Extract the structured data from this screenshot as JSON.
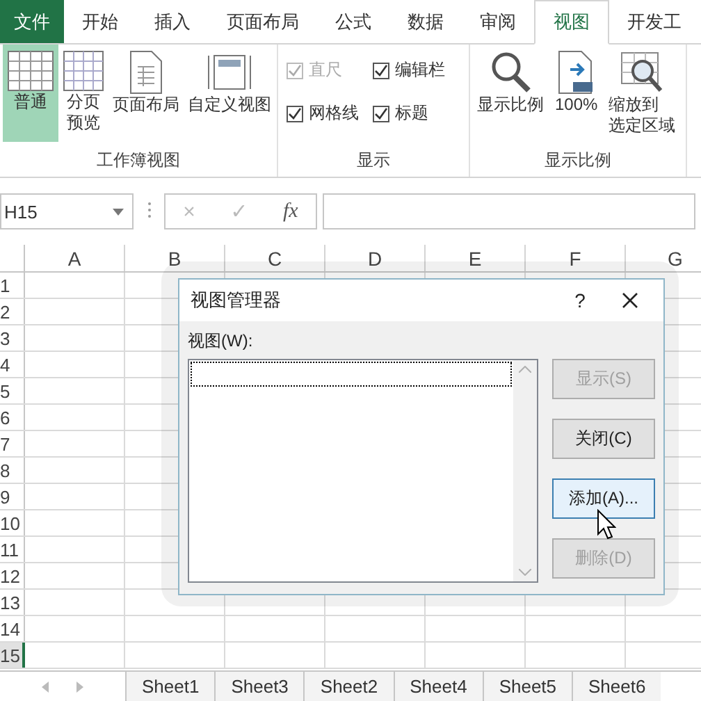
{
  "tabs": [
    {
      "label": "文件",
      "kind": "file",
      "selected": false
    },
    {
      "label": "开始",
      "kind": "tab",
      "selected": false
    },
    {
      "label": "插入",
      "kind": "tab",
      "selected": false
    },
    {
      "label": "页面布局",
      "kind": "tab",
      "selected": false
    },
    {
      "label": "公式",
      "kind": "tab",
      "selected": false
    },
    {
      "label": "数据",
      "kind": "tab",
      "selected": false
    },
    {
      "label": "审阅",
      "kind": "tab",
      "selected": false
    },
    {
      "label": "视图",
      "kind": "tab",
      "selected": true
    },
    {
      "label": "开发工",
      "kind": "tab",
      "selected": false
    }
  ],
  "ribbon": {
    "workbook_views": {
      "label": "工作簿视图",
      "buttons": [
        {
          "label": "普通",
          "selected": true
        },
        {
          "lines": [
            "分页",
            "预览"
          ],
          "selected": false
        },
        {
          "label": "页面布局",
          "selected": false
        },
        {
          "label": "自定义视图",
          "selected": false
        }
      ]
    },
    "show": {
      "label": "显示",
      "checkboxes": [
        {
          "label": "直尺",
          "checked": true,
          "disabled": true
        },
        {
          "label": "编辑栏",
          "checked": true,
          "disabled": false
        },
        {
          "label": "网格线",
          "checked": true,
          "disabled": false
        },
        {
          "label": "标题",
          "checked": true,
          "disabled": false
        }
      ]
    },
    "zoom": {
      "label": "显示比例",
      "buttons": [
        {
          "label": "显示比例"
        },
        {
          "label": "100%"
        },
        {
          "lines": [
            "缩放到",
            "选定区域"
          ]
        }
      ]
    }
  },
  "formula_bar": {
    "name_box": "H15",
    "cancel": "×",
    "enter": "✓",
    "function": "fx"
  },
  "grid": {
    "columns": [
      "A",
      "B",
      "C",
      "D",
      "E",
      "F",
      "G"
    ],
    "rows": [
      "1",
      "2",
      "3",
      "4",
      "5",
      "6",
      "7",
      "8",
      "9",
      "10",
      "11",
      "12",
      "13",
      "14",
      "15"
    ]
  },
  "sheet_tabs": [
    {
      "label": "Sheet1",
      "selected": false
    },
    {
      "label": "Sheet3",
      "selected": false
    },
    {
      "label": "Sheet2",
      "selected": false
    },
    {
      "label": "Sheet4",
      "selected": false
    },
    {
      "label": "Sheet5",
      "selected": false
    },
    {
      "label": "Sheet6",
      "selected": false
    }
  ],
  "dialog": {
    "title": "视图管理器",
    "help": "?",
    "list_label": "视图(W):",
    "buttons": [
      {
        "label": "显示(S)",
        "disabled": true,
        "hovered": false
      },
      {
        "label": "关闭(C)",
        "disabled": false,
        "hovered": false
      },
      {
        "label": "添加(A)...",
        "disabled": false,
        "hovered": true
      },
      {
        "label": "删除(D)",
        "disabled": true,
        "hovered": false
      }
    ]
  }
}
